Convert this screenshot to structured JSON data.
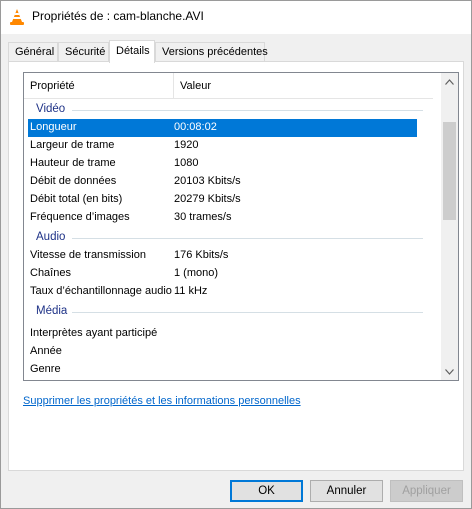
{
  "window": {
    "title": "Propriétés de : cam-blanche.AVI",
    "icon": "vlc-cone-icon"
  },
  "tabs": [
    {
      "label": "Général",
      "active": false
    },
    {
      "label": "Sécurité",
      "active": false
    },
    {
      "label": "Détails",
      "active": true
    },
    {
      "label": "Versions précédentes",
      "active": false
    }
  ],
  "details": {
    "columns": {
      "property": "Propriété",
      "value": "Valeur"
    },
    "groups": [
      {
        "name": "Vidéo",
        "rows": [
          {
            "property": "Longueur",
            "value": "00:08:02",
            "selected": true
          },
          {
            "property": "Largeur de trame",
            "value": "1920"
          },
          {
            "property": "Hauteur de trame",
            "value": "1080"
          },
          {
            "property": "Débit de données",
            "value": "20103 Kbits/s"
          },
          {
            "property": "Débit total (en bits)",
            "value": "20279 Kbits/s"
          },
          {
            "property": "Fréquence d’images",
            "value": "30 trames/s"
          }
        ]
      },
      {
        "name": "Audio",
        "rows": [
          {
            "property": "Vitesse de transmission",
            "value": "176 Kbits/s"
          },
          {
            "property": "Chaînes",
            "value": "1 (mono)"
          },
          {
            "property": "Taux d’échantillonnage audio",
            "value": "11 kHz"
          }
        ]
      },
      {
        "name": "Média",
        "rows": [
          {
            "property": "Interprètes ayant participé",
            "value": ""
          },
          {
            "property": "Année",
            "value": ""
          },
          {
            "property": "Genre",
            "value": ""
          }
        ]
      }
    ]
  },
  "remove_link": "Supprimer les propriétés et les informations personnelles",
  "buttons": {
    "ok": "OK",
    "cancel": "Annuler",
    "apply": "Appliquer"
  },
  "colors": {
    "selection": "#0078d7",
    "group_text": "#1e3287",
    "link": "#0066cc"
  }
}
